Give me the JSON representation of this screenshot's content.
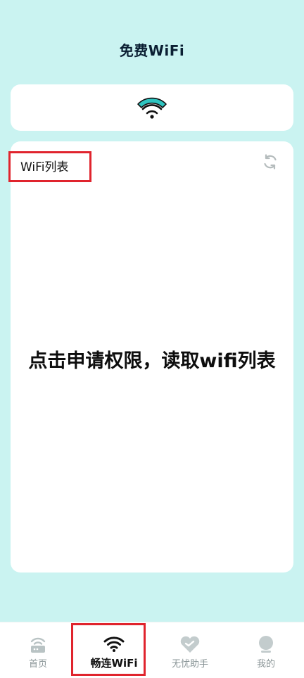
{
  "header": {
    "title": "免费WiFi"
  },
  "banner": {
    "icon": "wifi-icon",
    "accent_color": "#2ec4c0"
  },
  "wifi_list": {
    "title": "WiFi列表",
    "refresh_icon": "refresh-icon",
    "permission_prompt": "点击申请权限，读取wifi列表"
  },
  "tabbar": {
    "tabs": [
      {
        "label": "首页",
        "icon": "router-icon",
        "active": false
      },
      {
        "label": "畅连WiFi",
        "icon": "wifi-icon",
        "active": true
      },
      {
        "label": "无忧助手",
        "icon": "heart-shield-icon",
        "active": false
      },
      {
        "label": "我的",
        "icon": "user-icon",
        "active": false
      }
    ]
  },
  "colors": {
    "background": "#caf3f1",
    "card": "#ffffff",
    "highlight": "#e0242d",
    "inactive": "#8a9597"
  }
}
